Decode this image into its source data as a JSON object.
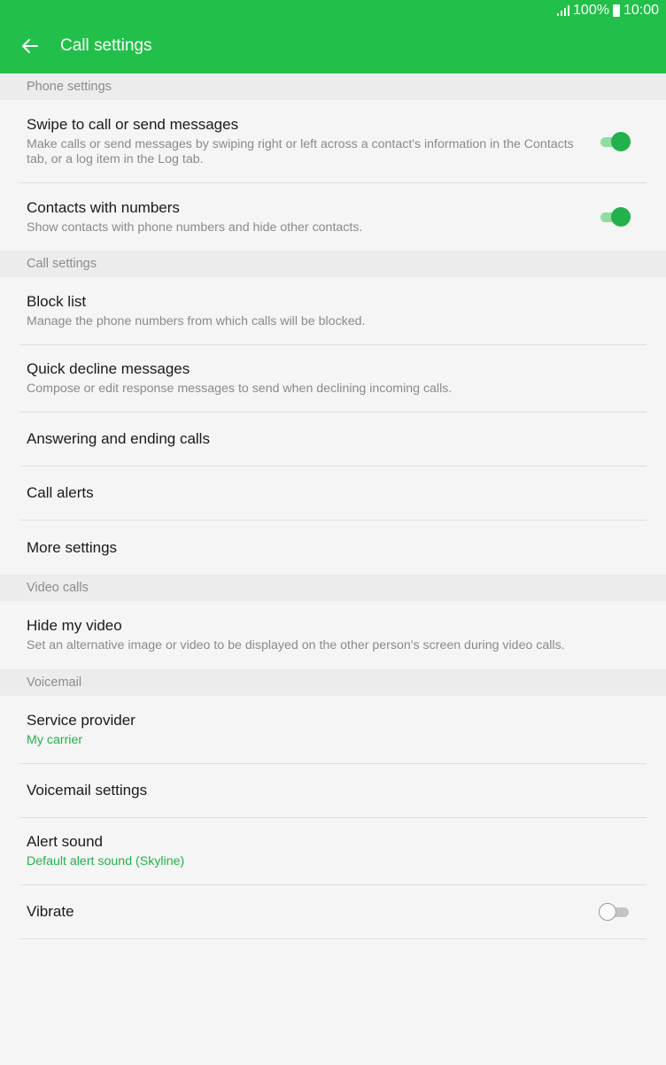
{
  "status_bar": {
    "battery": "100%",
    "time": "10:00"
  },
  "header": {
    "title": "Call settings"
  },
  "colors": {
    "accent": "#22c04a",
    "accent_text": "#22b14c"
  },
  "sections": {
    "phone_settings": {
      "label": "Phone settings",
      "items": [
        {
          "title": "Swipe to call or send messages",
          "subtitle": "Make calls or send messages by swiping right or left across a contact's information in the Contacts tab, or a log item in the Log tab.",
          "toggle": true
        },
        {
          "title": "Contacts with numbers",
          "subtitle": "Show contacts with phone numbers and hide other contacts.",
          "toggle": true
        }
      ]
    },
    "call_settings": {
      "label": "Call settings",
      "items": [
        {
          "title": "Block list",
          "subtitle": "Manage the phone numbers from which calls will be blocked."
        },
        {
          "title": "Quick decline messages",
          "subtitle": "Compose or edit response messages to send when declining incoming calls."
        },
        {
          "title": "Answering and ending calls"
        },
        {
          "title": "Call alerts"
        },
        {
          "title": "More settings"
        }
      ]
    },
    "video_calls": {
      "label": "Video calls",
      "items": [
        {
          "title": "Hide my video",
          "subtitle": "Set an alternative image or video to be displayed on the other person's screen during video calls."
        }
      ]
    },
    "voicemail": {
      "label": "Voicemail",
      "items": [
        {
          "title": "Service provider",
          "subtitle": "My carrier"
        },
        {
          "title": "Voicemail settings"
        },
        {
          "title": "Alert sound",
          "subtitle": "Default alert sound (Skyline)"
        },
        {
          "title": "Vibrate",
          "toggle": false
        }
      ]
    }
  }
}
